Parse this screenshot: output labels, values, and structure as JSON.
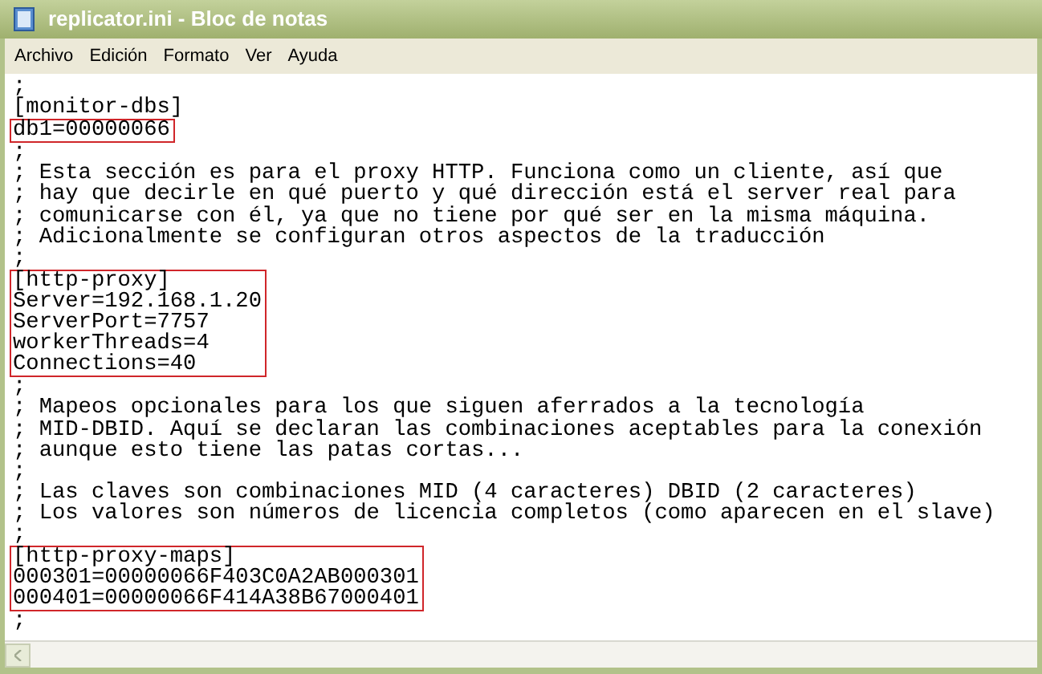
{
  "window": {
    "title": "replicator.ini - Bloc de notas"
  },
  "menu": [
    "Archivo",
    "Edición",
    "Formato",
    "Ver",
    "Ayuda"
  ],
  "blocks": [
    {
      "highlighted": false,
      "lines": [
        ";",
        "[monitor-dbs]"
      ]
    },
    {
      "highlighted": true,
      "lines": [
        "db1=00000066"
      ]
    },
    {
      "highlighted": false,
      "lines": [
        ";",
        "; Esta sección es para el proxy HTTP. Funciona como un cliente, así que",
        "; hay que decirle en qué puerto y qué dirección está el server real para",
        "; comunicarse con él, ya que no tiene por qué ser en la misma máquina.",
        "; Adicionalmente se configuran otros aspectos de la traducción",
        ";"
      ]
    },
    {
      "highlighted": true,
      "lines": [
        "[http-proxy]",
        "Server=192.168.1.20",
        "ServerPort=7757",
        "workerThreads=4",
        "Connections=40"
      ]
    },
    {
      "highlighted": false,
      "lines": [
        ";",
        "; Mapeos opcionales para los que siguen aferrados a la tecnología",
        "; MID-DBID. Aquí se declaran las combinaciones aceptables para la conexión",
        "; aunque esto tiene las patas cortas...",
        ";",
        "; Las claves son combinaciones MID (4 caracteres) DBID (2 caracteres)",
        "; Los valores son números de licencia completos (como aparecen en el slave)",
        ";"
      ]
    },
    {
      "highlighted": true,
      "lines": [
        "[http-proxy-maps]",
        "000301=00000066F403C0A2AB000301",
        "000401=00000066F414A38B67000401"
      ]
    },
    {
      "highlighted": false,
      "lines": [
        ";"
      ]
    }
  ]
}
